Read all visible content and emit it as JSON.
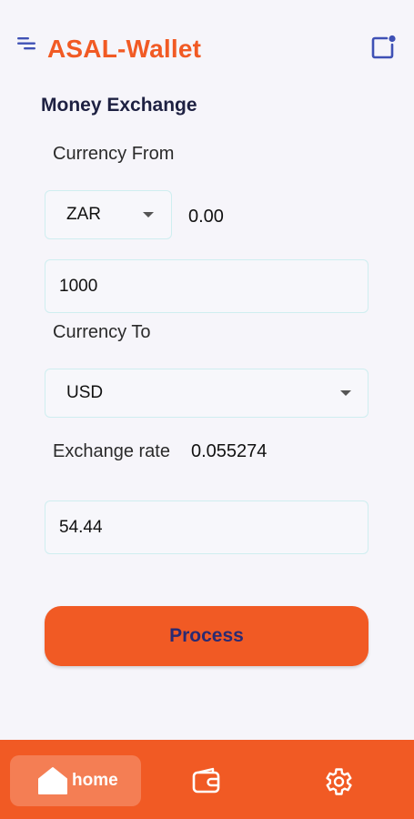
{
  "header": {
    "title": "ASAL-Wallet",
    "menu_icon": "menu-icon",
    "action_icon": "note-icon"
  },
  "exchange": {
    "section_title": "Money Exchange",
    "from_label": "Currency From",
    "from_currency": "ZAR",
    "from_balance": "0.00",
    "amount": "1000",
    "to_label": "Currency To",
    "to_currency": "USD",
    "rate_label": "Exchange rate",
    "rate_value": "0.055274",
    "result": "54.44",
    "process_label": "Process"
  },
  "nav": {
    "home_label": "home",
    "home_icon": "home-icon",
    "wallet_icon": "wallet-icon",
    "settings_icon": "gear-icon"
  },
  "colors": {
    "accent": "#f15a24",
    "title_dark": "#1e2142",
    "button_text": "#2a2a72",
    "field_border": "#cfeef0",
    "icon_blue": "#3f51b5"
  }
}
